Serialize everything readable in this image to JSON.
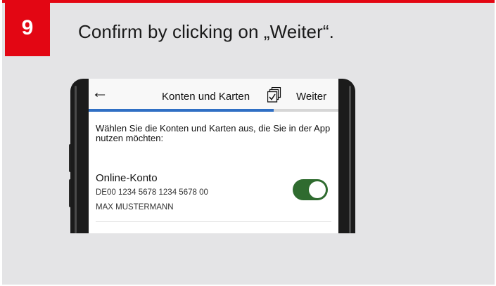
{
  "step": {
    "number": "9",
    "instruction": "Confirm by clicking on „Weiter“."
  },
  "colors": {
    "accent_red": "#e30613",
    "panel_bg": "#e4e4e6",
    "progress_blue": "#2f6fc4",
    "toggle_green": "#2f6b2f"
  },
  "app": {
    "nav": {
      "back_icon": "arrow-left-icon",
      "back_glyph": "←",
      "title": "Konten und Karten",
      "select_icon": "multi-select-check-icon",
      "next_label": "Weiter"
    },
    "progress": {
      "value": 0.74
    },
    "hint": "Wählen Sie die Konten und Karten aus, die Sie in der App nutzen möchten:",
    "account": {
      "title": "Online-Konto",
      "iban": "DE00 1234 5678 1234 5678 00",
      "holder": "MAX MUSTERMANN",
      "toggle_on": true
    }
  }
}
